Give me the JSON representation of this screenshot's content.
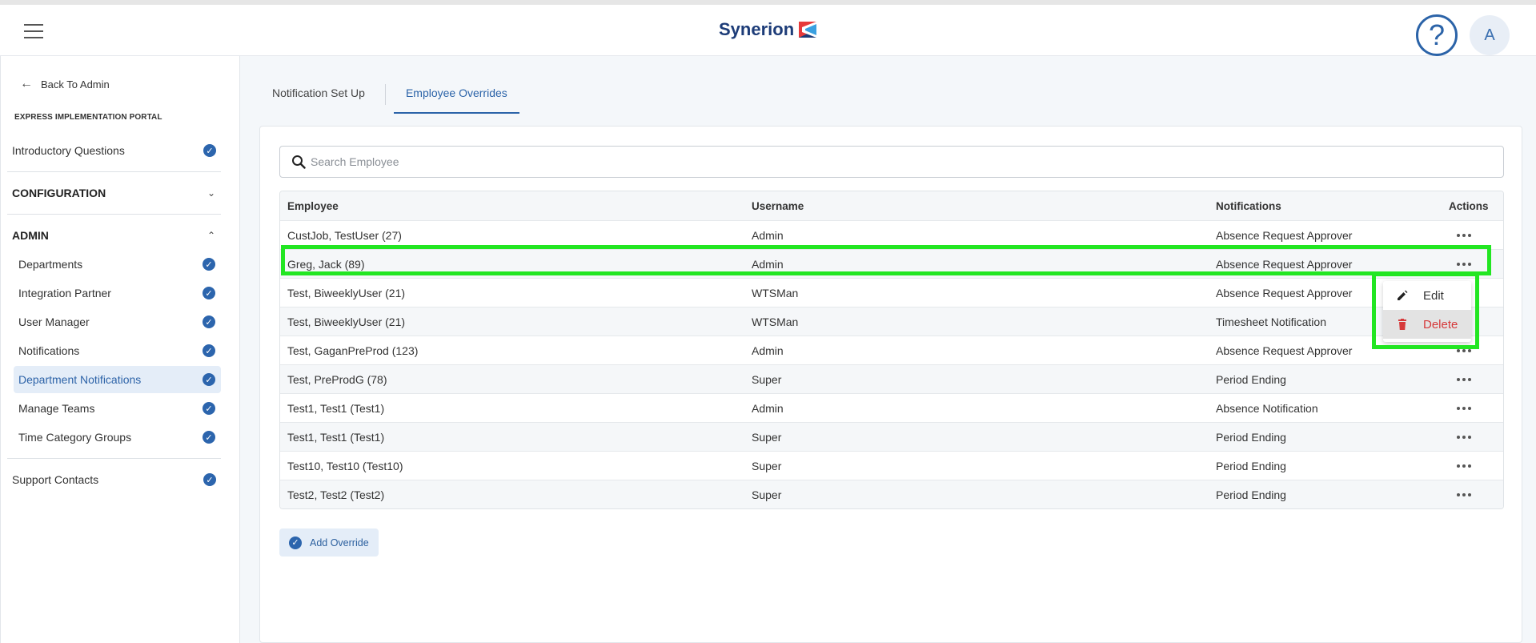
{
  "header": {
    "logo_text": "Synerion",
    "help_label": "?",
    "avatar_initial": "A",
    "brand_color": "#1d3c78"
  },
  "sidebar": {
    "back_label": "Back To Admin",
    "portal_label": "EXPRESS IMPLEMENTATION PORTAL",
    "intro_label": "Introductory Questions",
    "configuration_label": "CONFIGURATION",
    "admin_label": "ADMIN",
    "admin_items": [
      {
        "label": "Departments"
      },
      {
        "label": "Integration Partner"
      },
      {
        "label": "User Manager"
      },
      {
        "label": "Notifications"
      },
      {
        "label": "Department Notifications"
      },
      {
        "label": "Manage Teams"
      },
      {
        "label": "Time Category Groups"
      }
    ],
    "support_label": "Support Contacts"
  },
  "tabs": [
    {
      "label": "Notification Set Up"
    },
    {
      "label": "Employee Overrides"
    }
  ],
  "search": {
    "placeholder": "Search Employee"
  },
  "table": {
    "columns": [
      "Employee",
      "Username",
      "Notifications",
      "Actions"
    ],
    "rows": [
      {
        "employee": "CustJob, TestUser (27)",
        "username": "Admin",
        "notifications": "Absence Request Approver"
      },
      {
        "employee": "Greg, Jack (89)",
        "username": "Admin",
        "notifications": "Absence Request Approver"
      },
      {
        "employee": "Test, BiweeklyUser (21)",
        "username": "WTSMan",
        "notifications": "Absence Request Approver"
      },
      {
        "employee": "Test, BiweeklyUser (21)",
        "username": "WTSMan",
        "notifications": "Timesheet Notification"
      },
      {
        "employee": "Test, GaganPreProd (123)",
        "username": "Admin",
        "notifications": "Absence Request Approver"
      },
      {
        "employee": "Test, PreProdG (78)",
        "username": "Super",
        "notifications": "Period Ending"
      },
      {
        "employee": "Test1, Test1 (Test1)",
        "username": "Admin",
        "notifications": "Absence Notification"
      },
      {
        "employee": "Test1, Test1 (Test1)",
        "username": "Super",
        "notifications": "Period Ending"
      },
      {
        "employee": "Test10, Test10 (Test10)",
        "username": "Super",
        "notifications": "Period Ending"
      },
      {
        "employee": "Test2, Test2 (Test2)",
        "username": "Super",
        "notifications": "Period Ending"
      }
    ]
  },
  "context_menu": {
    "edit_label": "Edit",
    "delete_label": "Delete"
  },
  "add_override_label": "Add Override"
}
